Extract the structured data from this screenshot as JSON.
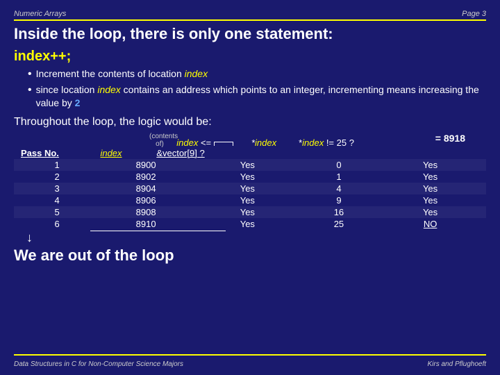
{
  "header": {
    "title": "Numeric Arrays",
    "page": "Page 3"
  },
  "slide_title": "Inside the loop, there is only one statement:",
  "section": {
    "heading": "index++;",
    "bullets": [
      {
        "text_before": "Increment the contents of location ",
        "italic": "index",
        "text_after": ""
      },
      {
        "text_before": "since location ",
        "italic": "index",
        "text_after": " contains an address which points to an integer, incrementing means increasing the value by ",
        "bold": "2"
      }
    ]
  },
  "throughout": "Throughout the loop, the logic would be:",
  "equals_label": "= 8918",
  "contents_of_label": "(contents of)",
  "col_headers": {
    "pass_no": "Pass No.",
    "index": "index",
    "lte": "index <= &vector[9] ?",
    "star_index": "*index",
    "not_equal": "*index != 25 ?"
  },
  "table_rows": [
    {
      "pass": "1",
      "index": "8900",
      "lte": "Yes",
      "star": "0",
      "neq": "Yes"
    },
    {
      "pass": "2",
      "index": "8902",
      "lte": "Yes",
      "star": "1",
      "neq": "Yes"
    },
    {
      "pass": "3",
      "index": "8904",
      "lte": "Yes",
      "star": "4",
      "neq": "Yes"
    },
    {
      "pass": "4",
      "index": "8906",
      "lte": "Yes",
      "star": "9",
      "neq": "Yes"
    },
    {
      "pass": "5",
      "index": "8908",
      "lte": "Yes",
      "star": "16",
      "neq": "Yes"
    },
    {
      "pass": "6",
      "index": "8910",
      "lte": "Yes",
      "star": "25",
      "neq": "NO"
    }
  ],
  "out_of_loop": "We are out of the loop",
  "footer": {
    "left": "Data Structures in C for Non-Computer Science Majors",
    "right": "Kirs and Pflughoeft"
  }
}
